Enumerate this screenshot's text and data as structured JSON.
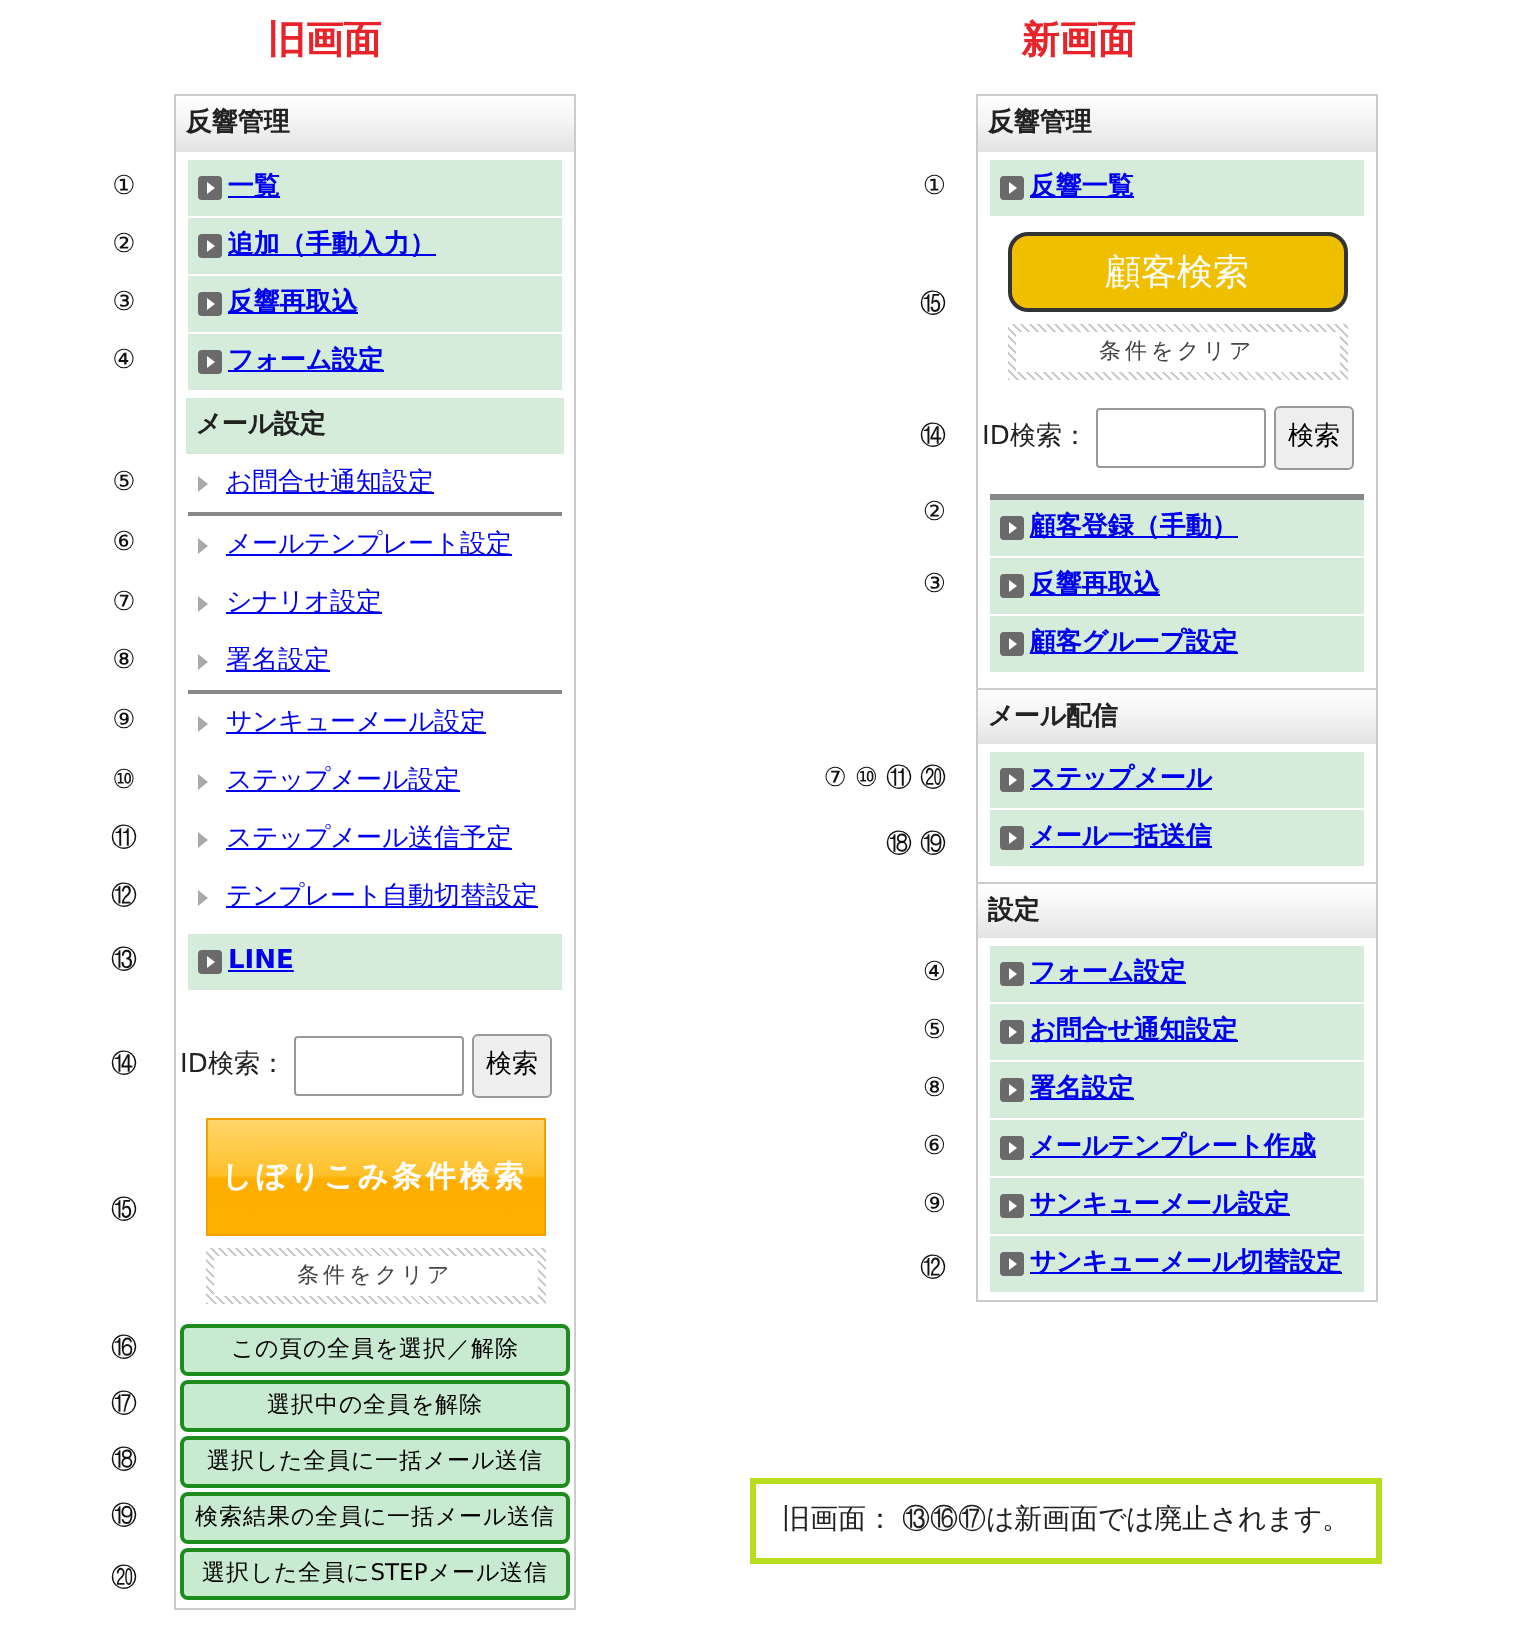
{
  "columns": [
    {
      "title": "旧画面",
      "items": [
        {
          "kind": "header",
          "label": "反響管理"
        },
        {
          "kind": "nav",
          "markers": [
            "①"
          ],
          "label": "一覧"
        },
        {
          "kind": "nav",
          "markers": [
            "②"
          ],
          "label": "追加（手動入力）"
        },
        {
          "kind": "nav",
          "markers": [
            "③"
          ],
          "label": "反響再取込"
        },
        {
          "kind": "nav",
          "markers": [
            "④"
          ],
          "label": "フォーム設定"
        },
        {
          "kind": "subheader",
          "label": "メール設定"
        },
        {
          "kind": "link",
          "markers": [
            "⑤"
          ],
          "label": "お問合せ通知設定",
          "divided": false
        },
        {
          "kind": "link",
          "markers": [
            "⑥"
          ],
          "label": "メールテンプレート設定",
          "divided": true
        },
        {
          "kind": "link",
          "markers": [
            "⑦"
          ],
          "label": "シナリオ設定",
          "divided": false
        },
        {
          "kind": "link",
          "markers": [
            "⑧"
          ],
          "label": "署名設定",
          "divided": false
        },
        {
          "kind": "link",
          "markers": [
            "⑨"
          ],
          "label": "サンキューメール設定",
          "divided": true
        },
        {
          "kind": "link",
          "markers": [
            "⑩"
          ],
          "label": "ステップメール設定",
          "divided": false
        },
        {
          "kind": "link",
          "markers": [
            "⑪"
          ],
          "label": "ステップメール送信予定",
          "divided": false
        },
        {
          "kind": "link",
          "markers": [
            "⑫"
          ],
          "label": "テンプレート自動切替設定",
          "divided": false
        },
        {
          "kind": "nav",
          "markers": [
            "⑬"
          ],
          "label": "LINE"
        },
        {
          "kind": "id_search",
          "markers": [
            "⑭"
          ],
          "label": "ID検索：",
          "button": "検索"
        },
        {
          "kind": "search_buttons",
          "markers": [
            "⑮"
          ],
          "button": "しぼりこみ条件検索",
          "clear": "条件をクリア"
        },
        {
          "kind": "action",
          "markers": [
            "⑯"
          ],
          "label": "この頁の全員を選択／解除"
        },
        {
          "kind": "action",
          "markers": [
            "⑰"
          ],
          "label": "選択中の全員を解除"
        },
        {
          "kind": "action",
          "markers": [
            "⑱"
          ],
          "label": "選択した全員に一括メール送信"
        },
        {
          "kind": "action",
          "markers": [
            "⑲"
          ],
          "label": "検索結果の全員に一括メール送信"
        },
        {
          "kind": "action",
          "markers": [
            "⑳"
          ],
          "label": "選択した全員にSTEPメール送信"
        }
      ]
    },
    {
      "title": "新画面",
      "items": [
        {
          "kind": "header",
          "label": "反響管理"
        },
        {
          "kind": "nav",
          "markers": [
            "①"
          ],
          "label": "反響一覧"
        },
        {
          "kind": "search_buttons",
          "markers": [
            "⑮"
          ],
          "button": "顧客検索",
          "clear": "条件をクリア"
        },
        {
          "kind": "id_search",
          "markers": [
            "⑭"
          ],
          "label": "ID検索：",
          "button": "検索"
        },
        {
          "kind": "nav",
          "markers": [
            "②"
          ],
          "label": "顧客登録（手動）",
          "divided": true
        },
        {
          "kind": "nav",
          "markers": [
            "③"
          ],
          "label": "反響再取込"
        },
        {
          "kind": "nav",
          "label": "顧客グループ設定"
        },
        {
          "kind": "header",
          "label": "メール配信"
        },
        {
          "kind": "nav",
          "markers": [
            "⑦",
            "⑩",
            "⑪",
            "⑳"
          ],
          "label": "ステップメール"
        },
        {
          "kind": "nav",
          "markers": [
            "⑱",
            "⑲"
          ],
          "label": "メール一括送信"
        },
        {
          "kind": "header",
          "label": "設定"
        },
        {
          "kind": "nav",
          "markers": [
            "④"
          ],
          "label": "フォーム設定"
        },
        {
          "kind": "nav",
          "markers": [
            "⑤"
          ],
          "label": "お問合せ通知設定"
        },
        {
          "kind": "nav",
          "markers": [
            "⑧"
          ],
          "label": "署名設定"
        },
        {
          "kind": "nav",
          "markers": [
            "⑥"
          ],
          "label": "メールテンプレート作成"
        },
        {
          "kind": "nav",
          "markers": [
            "⑨"
          ],
          "label": "サンキューメール設定"
        },
        {
          "kind": "nav",
          "markers": [
            "⑫"
          ],
          "label": "サンキューメール切替設定"
        }
      ]
    }
  ],
  "note": "旧画面： ⑬⑯⑰は新画面では廃止されます。"
}
